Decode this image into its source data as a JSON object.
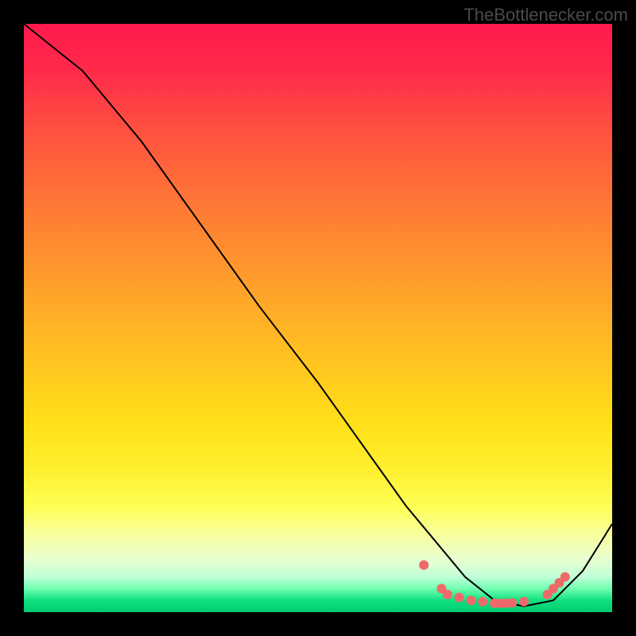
{
  "attribution": "TheBottlenecker.com",
  "chart_data": {
    "type": "line",
    "title": "",
    "xlabel": "",
    "ylabel": "",
    "xlim": [
      0,
      100
    ],
    "ylim": [
      0,
      100
    ],
    "series": [
      {
        "name": "bottleneck-curve",
        "x": [
          0,
          5,
          10,
          20,
          30,
          40,
          50,
          60,
          65,
          70,
          75,
          80,
          85,
          90,
          95,
          100
        ],
        "y": [
          100,
          96,
          92,
          80,
          66,
          52,
          39,
          25,
          18,
          12,
          6,
          2,
          1,
          2,
          7,
          15
        ]
      }
    ],
    "markers": {
      "name": "highlighted-points",
      "x": [
        68,
        71,
        72,
        74,
        76,
        78,
        80,
        81,
        82,
        83,
        85,
        89,
        90,
        91,
        92
      ],
      "y": [
        8,
        4,
        3,
        2.5,
        2,
        1.8,
        1.5,
        1.5,
        1.5,
        1.6,
        1.8,
        3,
        4,
        5,
        6
      ]
    }
  },
  "colors": {
    "gradient_top": "#ff1a4d",
    "gradient_bottom": "#00cc70",
    "curve": "#000000",
    "marker": "#ee6a6a",
    "background": "#000000"
  }
}
